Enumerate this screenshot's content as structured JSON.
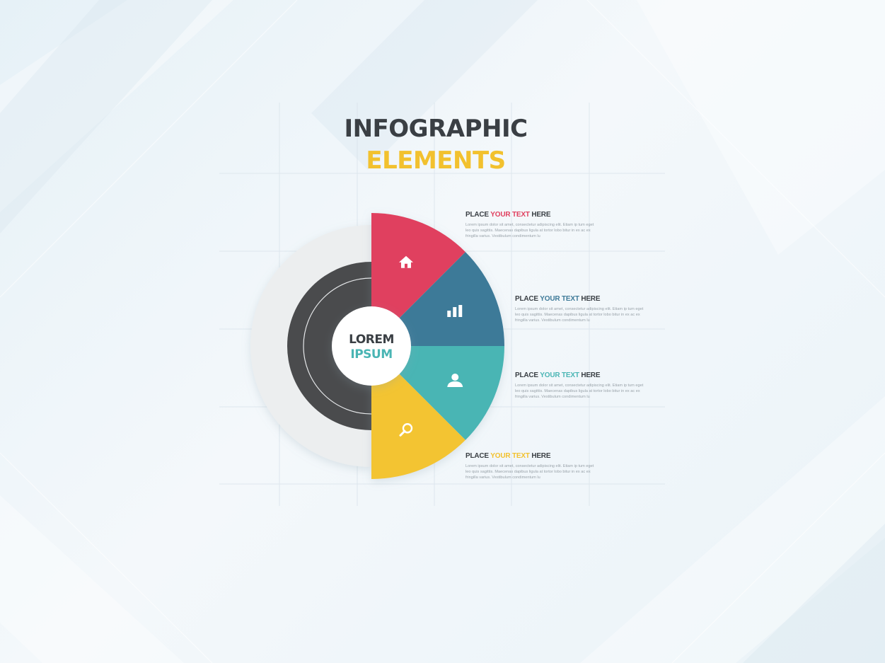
{
  "colors": {
    "title_dark": "#3a3f44",
    "title_accent": "#f2c12e",
    "segment_red": "#e0405f",
    "segment_blue": "#3e7a98",
    "segment_teal": "#4ab5b4",
    "segment_yellow": "#f3c431",
    "inner_ring": "#4a4b4d",
    "outer_ring": "#eceeef"
  },
  "title": {
    "line1": "INFOGRAPHIC",
    "line2": "ELEMENTS"
  },
  "center": {
    "line1": "LOREM",
    "line2": "IPSUM"
  },
  "segments": [
    {
      "icon": "home-icon",
      "color": "#e0405f"
    },
    {
      "icon": "bar-chart-icon",
      "color": "#3e7a98"
    },
    {
      "icon": "user-icon",
      "color": "#4ab5b4"
    },
    {
      "icon": "search-icon",
      "color": "#f3c431"
    }
  ],
  "items": [
    {
      "prefix": "PLACE ",
      "highlight": "YOUR TEXT",
      "suffix": " HERE",
      "highlight_color": "#e0405f",
      "body": "Lorem ipsum dolor sit amet, consectetur adipiscing elit. Etiam ip tum eget leo quis sagittis. Maecenas dapibus ligula at tortor lobo bitur in ex ac ex fringilla varius. Vestibulum condimentum lu"
    },
    {
      "prefix": "PLACE ",
      "highlight": "YOUR TEXT",
      "suffix": " HERE",
      "highlight_color": "#3e7a98",
      "body": "Lorem ipsum dolor sit amet, consectetur adipiscing elit. Etiam ip tum eget leo quis sagittis. Maecenas dapibus ligula at tortor lobo bitur in ex ac ex fringilla varius. Vestibulum condimentum lu"
    },
    {
      "prefix": "PLACE ",
      "highlight": "YOUR TEXT",
      "suffix": " HERE",
      "highlight_color": "#4ab5b4",
      "body": "Lorem ipsum dolor sit amet, consectetur adipiscing elit. Etiam ip tum eget leo quis sagittis. Maecenas dapibus ligula at tortor lobo bitur in ex ac ex fringilla varius. Vestibulum condimentum lu"
    },
    {
      "prefix": "PLACE ",
      "highlight": "YOUR TEXT",
      "suffix": " HERE",
      "highlight_color": "#f2c12e",
      "body": "Lorem ipsum dolor sit amet, consectetur adipiscing elit. Etiam ip tum eget leo quis sagittis. Maecenas dapibus ligula at tortor lobo bitur in ex ac ex fringilla varius. Vestibulum condimentum lu"
    }
  ]
}
